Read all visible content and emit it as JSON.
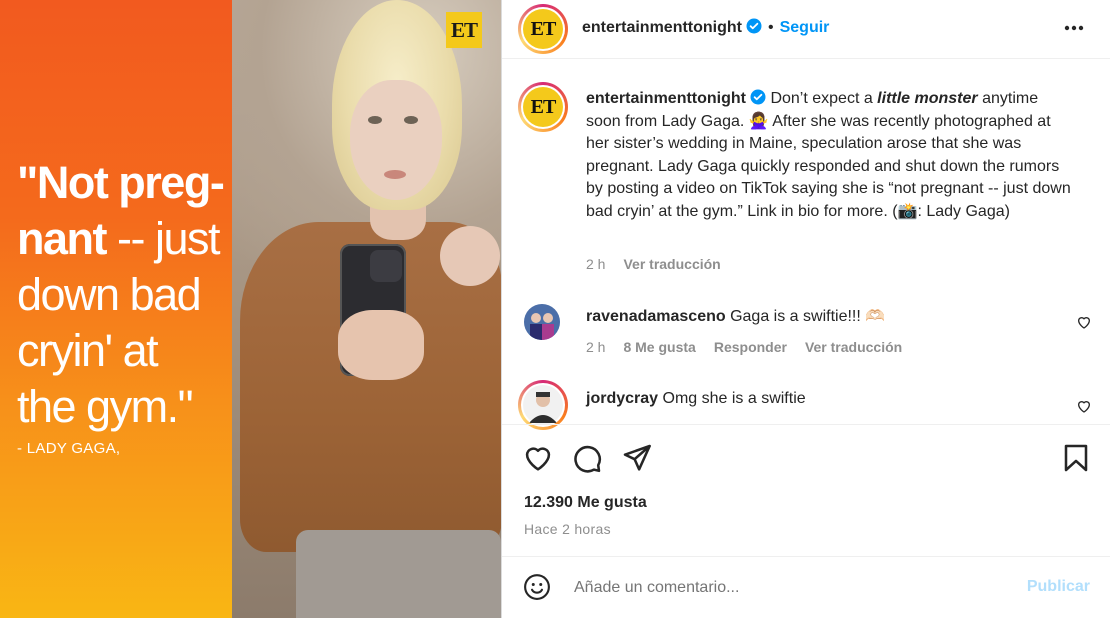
{
  "media": {
    "quote_lines": [
      {
        "bold": "\"Not preg-",
        "light": ""
      },
      {
        "bold": "nant",
        "light": " -- just"
      },
      {
        "bold": "",
        "light": "down bad"
      },
      {
        "bold": "",
        "light": "cryin' at"
      },
      {
        "bold": "",
        "light": "the gym.\""
      }
    ],
    "attribution": "- LADY GAGA,",
    "badge": "ET"
  },
  "header": {
    "avatar_text": "ET",
    "username": "entertainmenttonight",
    "separator": "•",
    "follow_label": "Seguir",
    "more_icon": "more-horizontal-icon"
  },
  "caption": {
    "avatar_text": "ET",
    "username": "entertainmenttonight",
    "text_before": " Don’t expect a ",
    "emphasis": "little monster",
    "text_after": " anytime soon from Lady Gaga. 🙅‍♀️ After she was recently photographed at her sister’s wedding in Maine, speculation arose that she was pregnant. Lady Gaga quickly responded and shut down the rumors by posting a video on TikTok saying she is “not pregnant -- just down bad cryin’ at the gym.” Link in bio for more. (📸: Lady Gaga)",
    "time": "2 h",
    "translate": "Ver traducción"
  },
  "comments": [
    {
      "username": "ravenadamasceno",
      "text": " Gaga is a swiftie!!! 🫶🏻",
      "time": "2 h",
      "likes": "8 Me gusta",
      "reply": "Responder",
      "translate": "Ver traducción"
    },
    {
      "username": "jordycray",
      "text": " Omg she is a swiftie"
    }
  ],
  "actions": {
    "like_icon": "heart-icon",
    "comment_icon": "comment-icon",
    "share_icon": "paper-plane-icon",
    "save_icon": "bookmark-icon"
  },
  "likes_label": "12.390 Me gusta",
  "time_ago": "Hace 2 horas",
  "add_comment": {
    "placeholder": "Añade un comentario...",
    "publish_label": "Publicar",
    "emoji_icon": "smiley-icon"
  },
  "colors": {
    "accent": "#0095f6",
    "publish_disabled": "#b2dffc",
    "brand_yellow": "#f4c91b",
    "muted": "#8e8e8e"
  }
}
